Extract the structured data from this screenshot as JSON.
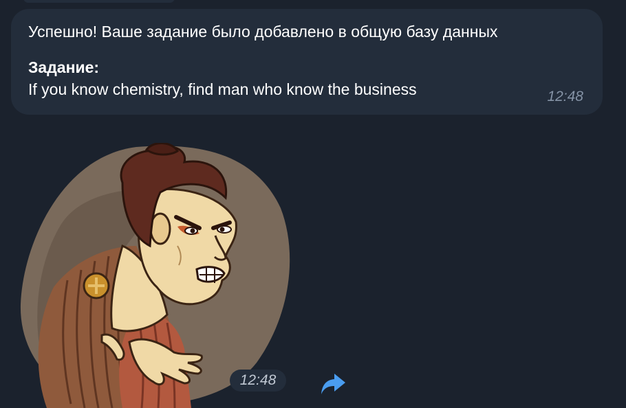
{
  "message": {
    "line1": "Успешно! Ваше задание было добавлено в общую базу данных",
    "label": "Задание:",
    "task": "If you know chemistry, find man who know the business",
    "time": "12:48"
  },
  "sticker": {
    "time": "12:48"
  },
  "icons": {
    "forward": "forward-arrow-icon"
  },
  "colors": {
    "background": "#1b222d",
    "bubble": "#232d3b",
    "timestamp": "#8593a6",
    "accent": "#4a9df0"
  }
}
